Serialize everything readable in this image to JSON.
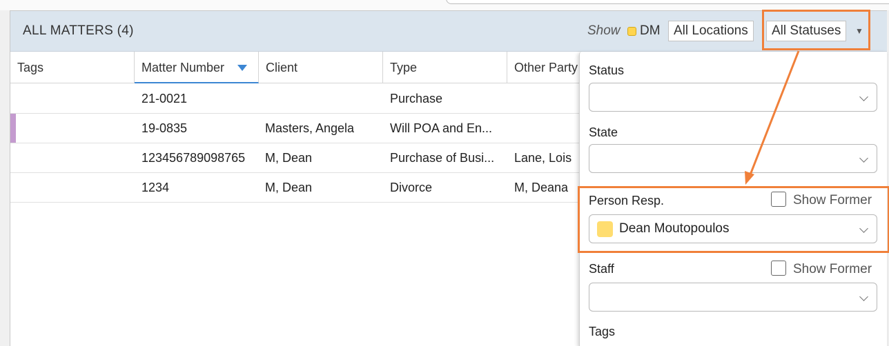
{
  "header": {
    "title": "ALL MATTERS (4)",
    "show_label": "Show",
    "dm_label": "DM",
    "locations_filter": "All Locations",
    "statuses_filter": "All Statuses",
    "dm_color": "#ffd54f"
  },
  "columns": [
    {
      "label": "Tags"
    },
    {
      "label": "Matter Number",
      "sorted": true
    },
    {
      "label": "Client"
    },
    {
      "label": "Type"
    },
    {
      "label": "Other Party"
    }
  ],
  "rows": [
    {
      "matter_number": "21-0021",
      "client": "",
      "type": "Purchase",
      "other_party": "",
      "tag_color": ""
    },
    {
      "matter_number": "19-0835",
      "client": "Masters, Angela",
      "type": "Will POA and En...",
      "other_party": "",
      "tag_color": "#c49bcf"
    },
    {
      "matter_number": "123456789098765",
      "client": "M, Dean",
      "type": "Purchase of Busi...",
      "other_party": "Lane, Lois",
      "tag_color": ""
    },
    {
      "matter_number": "1234",
      "client": "M, Dean",
      "type": "Divorce",
      "other_party": "M, Deana",
      "tag_color": ""
    }
  ],
  "filter_dropdown": {
    "status_label": "Status",
    "status_value": "",
    "state_label": "State",
    "state_value": "",
    "person_resp_label": "Person Resp.",
    "person_resp_show_former": "Show Former",
    "person_resp_value": "Dean Moutopoulos",
    "person_color": "#ffdd70",
    "staff_label": "Staff",
    "staff_show_former": "Show Former",
    "staff_value": "",
    "tags_label": "Tags"
  },
  "annotation_color": "#f0803a"
}
